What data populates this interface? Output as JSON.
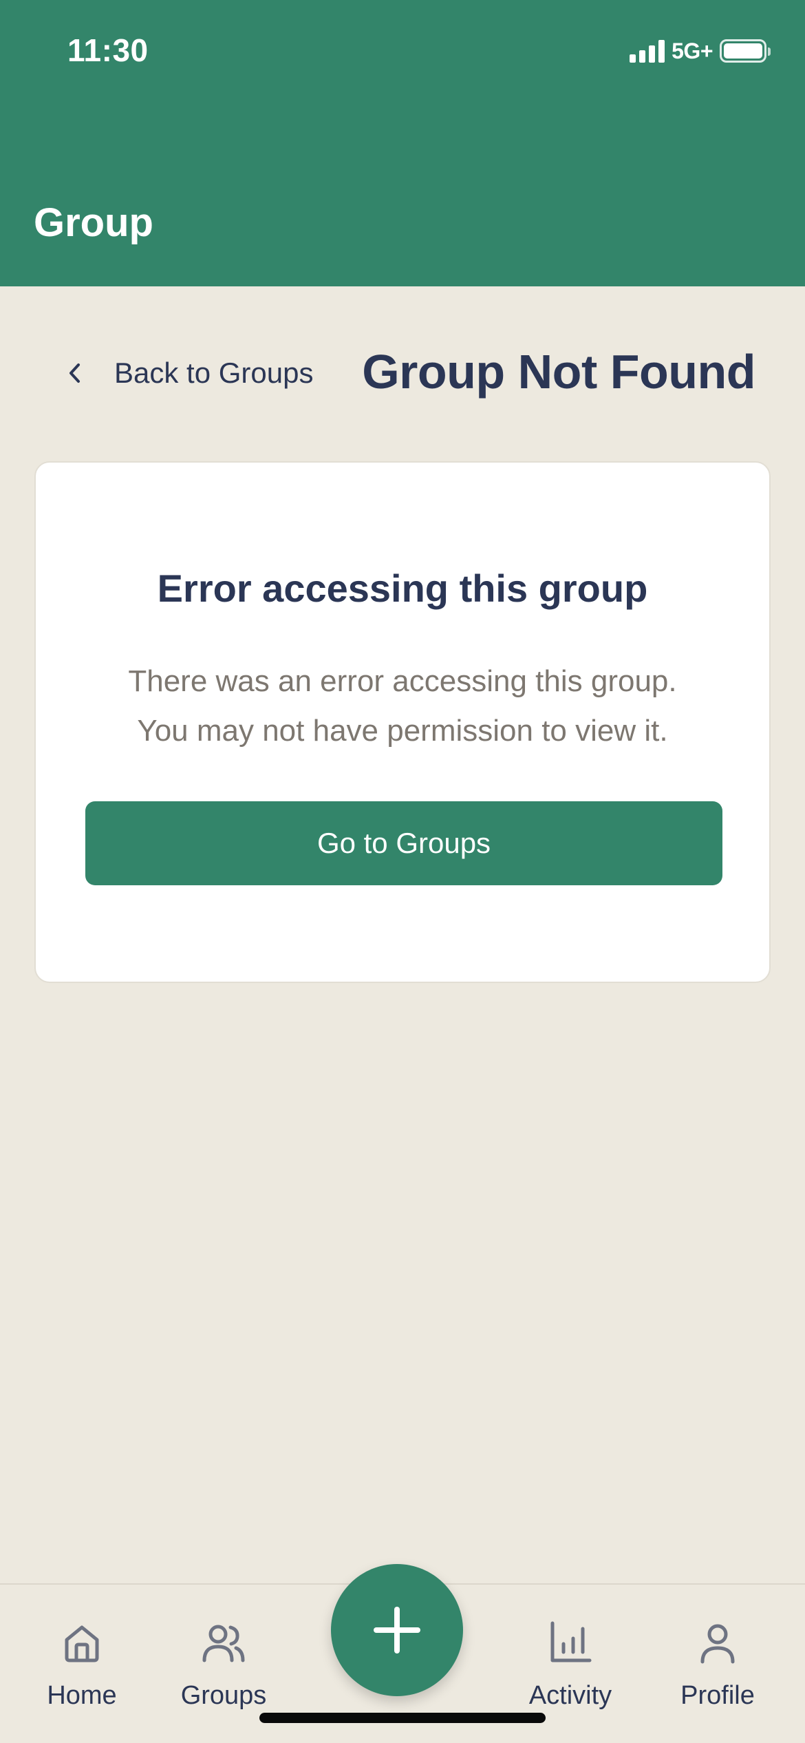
{
  "status_bar": {
    "time": "11:30",
    "network": "5G+",
    "signal_bars": 4,
    "battery_level": 1.0
  },
  "header": {
    "title": "Group",
    "background_color": "#33856A"
  },
  "title_row": {
    "back_label": "Back to Groups",
    "back_icon": "chevron-left-icon",
    "page_title": "Group Not Found"
  },
  "error_card": {
    "title": "Error accessing this group",
    "message_line1": "There was an error accessing this group.",
    "message_line2": "You may not have permission to view it.",
    "button_label": "Go to Groups"
  },
  "bottom_nav": {
    "items": [
      {
        "label": "Home",
        "icon": "home-icon"
      },
      {
        "label": "Groups",
        "icon": "users-icon"
      },
      {
        "label": "Activity",
        "icon": "bar-chart-icon"
      },
      {
        "label": "Profile",
        "icon": "user-icon"
      }
    ],
    "fab_icon": "plus-icon"
  },
  "colors": {
    "accent": "#33856A",
    "background": "#EDE9DF",
    "heading": "#2B3655",
    "muted_text": "#7D7770",
    "icon_gray": "#6E7382"
  }
}
